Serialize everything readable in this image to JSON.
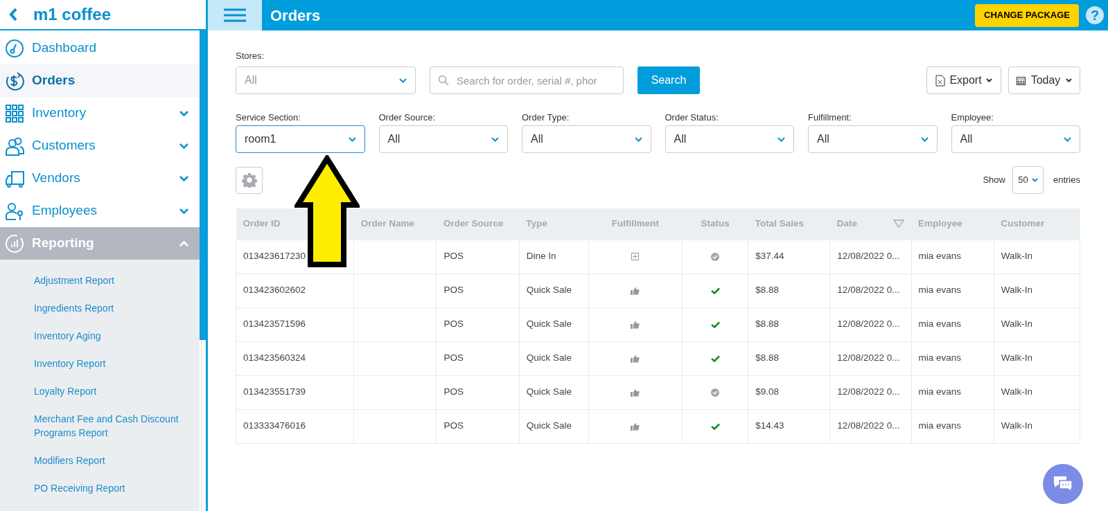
{
  "sidebar": {
    "brand": "m1 coffee",
    "items": [
      {
        "kind": "link",
        "label": "Dashboard",
        "selected": false
      },
      {
        "kind": "link",
        "label": "Orders",
        "selected": true
      },
      {
        "kind": "group",
        "label": "Inventory",
        "selected": false,
        "expanded": false
      },
      {
        "kind": "group",
        "label": "Customers",
        "selected": false,
        "expanded": false
      },
      {
        "kind": "group",
        "label": "Vendors",
        "selected": false,
        "expanded": false
      },
      {
        "kind": "group",
        "label": "Employees",
        "selected": false,
        "expanded": false
      },
      {
        "kind": "group",
        "label": "Reporting",
        "selected": false,
        "expanded": true,
        "children": [
          "Adjustment Report",
          "Ingredients Report",
          "Inventory Aging",
          "Inventory Report",
          "Loyalty Report",
          "Merchant Fee and Cash Discount Programs Report",
          "Modifiers Report",
          "PO Receiving Report"
        ]
      }
    ]
  },
  "header": {
    "title": "Orders",
    "package_button": "CHANGE PACKAGE",
    "help": "?"
  },
  "toolbar": {
    "stores_label": "Stores:",
    "stores_value": "All",
    "search_placeholder": "Search for order, serial #, phor",
    "search_button": "Search",
    "export_button": "Export",
    "date_button": "Today"
  },
  "filters": [
    {
      "label": "Service Section:",
      "value": "room1",
      "focused": true
    },
    {
      "label": "Order Source:",
      "value": "All",
      "focused": false
    },
    {
      "label": "Order Type:",
      "value": "All",
      "focused": false
    },
    {
      "label": "Order Status:",
      "value": "All",
      "focused": false
    },
    {
      "label": "Fulfillment:",
      "value": "All",
      "focused": false
    },
    {
      "label": "Employee:",
      "value": "All",
      "focused": false
    }
  ],
  "entries": {
    "show": "Show",
    "value": "50",
    "suffix": "entries"
  },
  "table": {
    "columns": [
      "Order ID",
      "Order Name",
      "Order Source",
      "Type",
      "Fulfillment",
      "Status",
      "Total Sales",
      "Date",
      "Employee",
      "Customer"
    ],
    "rows": [
      {
        "order_id": "013423617230",
        "source": "POS",
        "type": "Dine In",
        "fulfillment": {
          "kind": "expand"
        },
        "status": {
          "kind": "circle-check"
        },
        "total": "$37.44",
        "date": "12/08/2022 0...",
        "employee": "mia evans",
        "customer": "Walk-In"
      },
      {
        "order_id": "013423602602",
        "source": "POS",
        "type": "Quick Sale",
        "fulfillment": {
          "kind": "thumbs-up"
        },
        "status": {
          "kind": "check"
        },
        "total": "$8.88",
        "date": "12/08/2022 0...",
        "employee": "mia evans",
        "customer": "Walk-In"
      },
      {
        "order_id": "013423571596",
        "source": "POS",
        "type": "Quick Sale",
        "fulfillment": {
          "kind": "thumbs-up"
        },
        "status": {
          "kind": "check"
        },
        "total": "$8.88",
        "date": "12/08/2022 0...",
        "employee": "mia evans",
        "customer": "Walk-In"
      },
      {
        "order_id": "013423560324",
        "source": "POS",
        "type": "Quick Sale",
        "fulfillment": {
          "kind": "thumbs-up"
        },
        "status": {
          "kind": "check"
        },
        "total": "$8.88",
        "date": "12/08/2022 0...",
        "employee": "mia evans",
        "customer": "Walk-In"
      },
      {
        "order_id": "013423551739",
        "source": "POS",
        "type": "Quick Sale",
        "fulfillment": {
          "kind": "thumbs-up"
        },
        "status": {
          "kind": "circle-check"
        },
        "total": "$9.08",
        "date": "12/08/2022 0...",
        "employee": "mia evans",
        "customer": "Walk-In"
      },
      {
        "order_id": "013333476016",
        "source": "POS",
        "type": "Quick Sale",
        "fulfillment": {
          "kind": "thumbs-up"
        },
        "status": {
          "kind": "check"
        },
        "total": "$14.43",
        "date": "12/08/2022 0...",
        "employee": "mia evans",
        "customer": "Walk-In"
      }
    ]
  }
}
